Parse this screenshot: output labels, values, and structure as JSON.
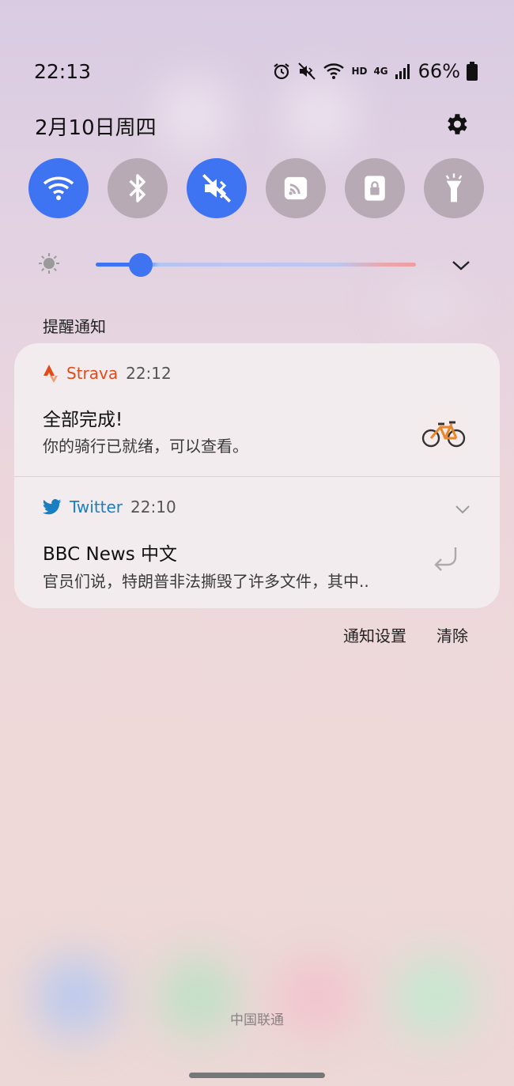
{
  "status_bar": {
    "time": "22:13",
    "battery_percent": "66%",
    "network_hd": "HD",
    "network_gen": "4G",
    "icons": [
      "alarm-icon",
      "mute-icon",
      "wifi-icon",
      "signal-icon",
      "battery-icon"
    ]
  },
  "header": {
    "date": "2月10日周四"
  },
  "quick_settings": [
    {
      "name": "wifi",
      "icon": "wifi-icon",
      "on": true
    },
    {
      "name": "bluetooth",
      "icon": "bluetooth-icon",
      "on": false
    },
    {
      "name": "sound",
      "icon": "mute-icon",
      "on": true
    },
    {
      "name": "nfc",
      "icon": "nfc-icon",
      "on": false
    },
    {
      "name": "screen_lock",
      "icon": "lock-icon",
      "on": false
    },
    {
      "name": "flashlight",
      "icon": "flashlight-icon",
      "on": false
    }
  ],
  "brightness": {
    "level": 0.14
  },
  "notifications": {
    "section_title": "提醒通知",
    "items": [
      {
        "app": "Strava",
        "time": "22:12",
        "title": "全部完成!",
        "body": "你的骑行已就绪，可以查看。",
        "app_color": "#e14b1a"
      },
      {
        "app": "Twitter",
        "time": "22:10",
        "title": "BBC News 中文",
        "body": "官员们说，特朗普非法撕毁了许多文件，其中..",
        "app_color": "#1a7fc1"
      }
    ],
    "settings_label": "通知设置",
    "clear_label": "清除"
  },
  "footer": {
    "carrier": "中国联通"
  },
  "colors": {
    "accent": "#3e73f2",
    "toggle_off": "#b7aab4"
  }
}
